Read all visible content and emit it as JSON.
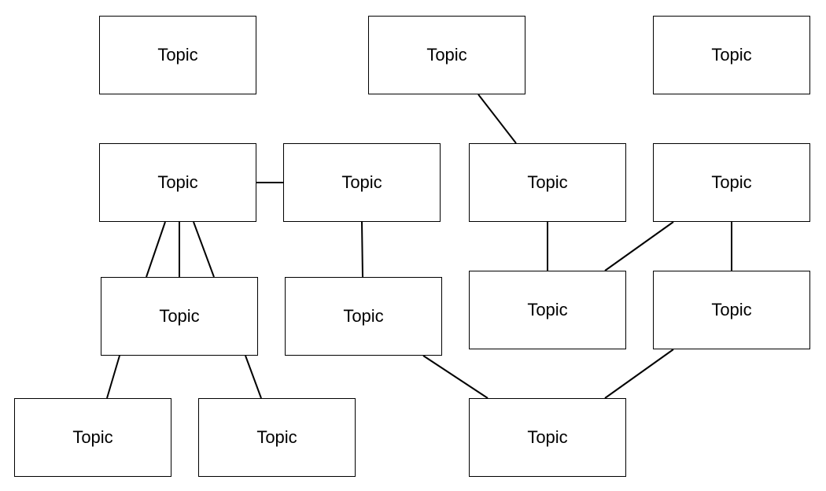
{
  "nodes": [
    {
      "id": "n1",
      "label": "Topic"
    },
    {
      "id": "n2",
      "label": "Topic"
    },
    {
      "id": "n3",
      "label": "Topic"
    },
    {
      "id": "n4",
      "label": "Topic"
    },
    {
      "id": "n5",
      "label": "Topic"
    },
    {
      "id": "n6",
      "label": "Topic"
    },
    {
      "id": "n7",
      "label": "Topic"
    },
    {
      "id": "n8",
      "label": "Topic"
    },
    {
      "id": "n9",
      "label": "Topic"
    },
    {
      "id": "n10",
      "label": "Topic"
    },
    {
      "id": "n11",
      "label": "Topic"
    },
    {
      "id": "n12",
      "label": "Topic"
    },
    {
      "id": "n13",
      "label": "Topic"
    },
    {
      "id": "n14",
      "label": "Topic"
    }
  ],
  "edges": [
    [
      "n2",
      "n6"
    ],
    [
      "n4",
      "n5"
    ],
    [
      "n5",
      "n9"
    ],
    [
      "n4",
      "n8"
    ],
    [
      "n4",
      "n8"
    ],
    [
      "n4",
      "n8"
    ],
    [
      "n6",
      "n10"
    ],
    [
      "n7",
      "n10"
    ],
    [
      "n7",
      "n11"
    ],
    [
      "n8",
      "n12"
    ],
    [
      "n8",
      "n13"
    ],
    [
      "n9",
      "n14"
    ],
    [
      "n11",
      "n14"
    ]
  ],
  "colors": {
    "stroke": "#000000",
    "fill": "#ffffff"
  }
}
